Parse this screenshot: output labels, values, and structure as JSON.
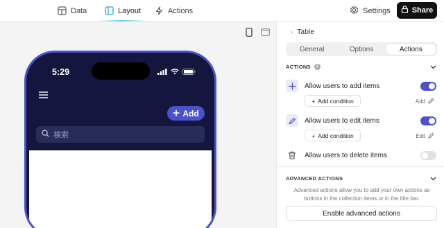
{
  "topbar": {
    "tabs": [
      {
        "label": "Data",
        "icon": "table-icon"
      },
      {
        "label": "Layout",
        "icon": "layout-icon",
        "active": true
      },
      {
        "label": "Actions",
        "icon": "lightning-icon"
      }
    ],
    "settings_label": "Settings",
    "share_label": "Share"
  },
  "phone": {
    "time": "5:29",
    "add_label": "Add",
    "search_placeholder": "検索"
  },
  "panel": {
    "breadcrumb": "Table",
    "segments": [
      "General",
      "Options",
      "Actions"
    ],
    "active_segment": "Actions",
    "actions_header": "ACTIONS",
    "items": [
      {
        "label": "Allow users to add items",
        "enabled": true,
        "condition_label": "Add condition",
        "link_label": "Add"
      },
      {
        "label": "Allow users to edit items",
        "enabled": true,
        "condition_label": "Add condition",
        "link_label": "Edit"
      },
      {
        "label": "Allow users to delete items",
        "enabled": false
      }
    ],
    "advanced_header": "ADVANCED ACTIONS",
    "advanced_desc": "Advanced actions allow you to add your own actions as buttons in the collection items or in the title bar.",
    "enable_advanced_label": "Enable advanced actions"
  },
  "colors": {
    "accent": "#4a52cc",
    "phone_bg": "#15163e",
    "share_bg": "#111111"
  }
}
